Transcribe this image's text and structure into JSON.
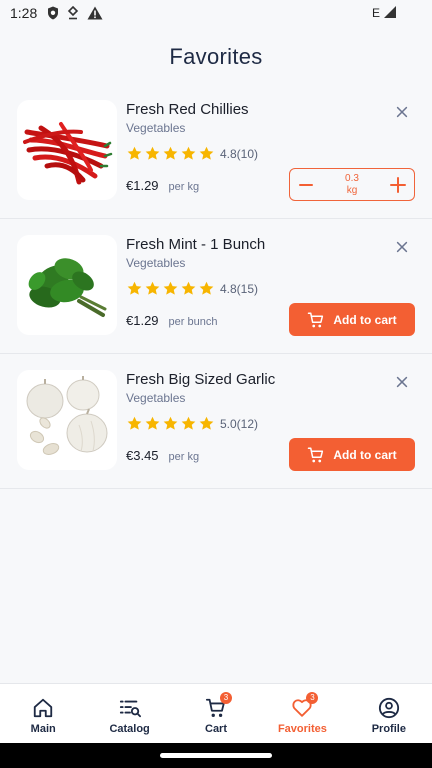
{
  "status": {
    "time": "1:28",
    "network": "E"
  },
  "page": {
    "title": "Favorites"
  },
  "items": [
    {
      "name": "Fresh Red Chillies",
      "category": "Vegetables",
      "rating": "4.8(10)",
      "price": "€1.29",
      "unit": "per kg",
      "stepper": {
        "qty_value": "0.3",
        "qty_unit": "kg"
      }
    },
    {
      "name": "Fresh Mint - 1 Bunch",
      "category": "Vegetables",
      "rating": "4.8(15)",
      "price": "€1.29",
      "unit": "per bunch",
      "button": "Add to cart"
    },
    {
      "name": "Fresh Big Sized Garlic",
      "category": "Vegetables",
      "rating": "5.0(12)",
      "price": "€3.45",
      "unit": "per kg",
      "button": "Add to cart"
    }
  ],
  "nav": {
    "items": [
      {
        "label": "Main",
        "icon": "home-icon"
      },
      {
        "label": "Catalog",
        "icon": "catalog-icon"
      },
      {
        "label": "Cart",
        "icon": "cart-icon",
        "badge": "3"
      },
      {
        "label": "Favorites",
        "icon": "heart-icon",
        "badge": "3"
      },
      {
        "label": "Profile",
        "icon": "profile-icon"
      }
    ],
    "active": "Favorites"
  },
  "colors": {
    "accent": "#f35f33",
    "star": "#f7b500",
    "title": "#1e2a44"
  }
}
